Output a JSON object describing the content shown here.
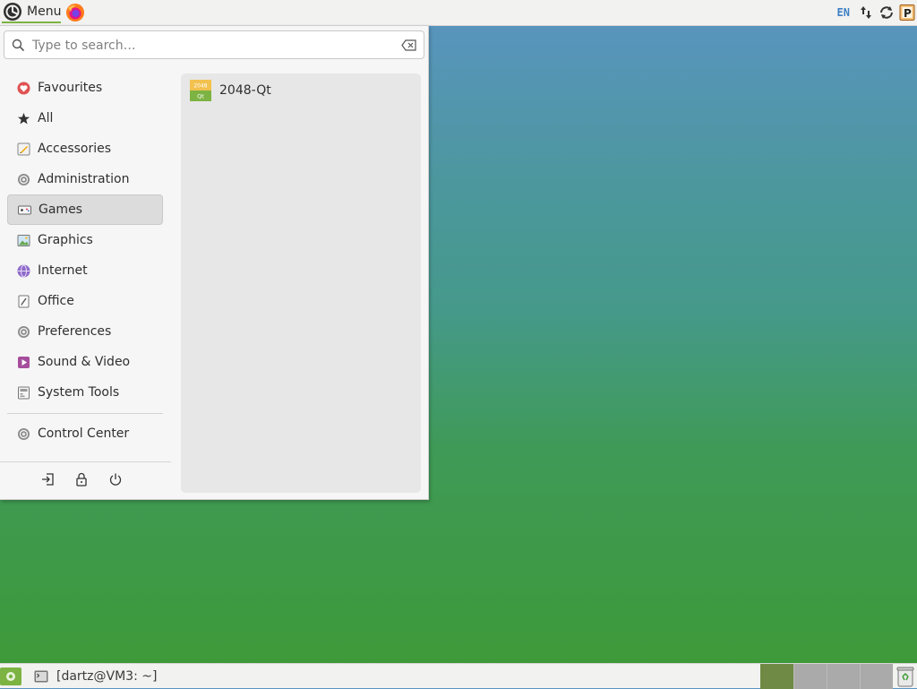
{
  "top_panel": {
    "menu_label": "Menu",
    "keyboard_layout": "EN",
    "launchers": [
      "mate-logo-icon",
      "firefox-icon"
    ],
    "tray_icons": [
      "network-icon",
      "update-icon",
      "parcellite-clipboard-icon"
    ]
  },
  "menu": {
    "search": {
      "placeholder": "Type to search…",
      "value": ""
    },
    "categories": [
      {
        "label": "Favourites",
        "icon": "heart-icon",
        "color": "#e05252"
      },
      {
        "label": "All",
        "icon": "star-icon",
        "color": "#333333"
      },
      {
        "label": "Accessories",
        "icon": "accessories-icon",
        "color": "#4a7cc9"
      },
      {
        "label": "Administration",
        "icon": "gear-icon",
        "color": "#7a7a7a"
      },
      {
        "label": "Games",
        "icon": "gamepad-icon",
        "color": "#555555",
        "selected": true
      },
      {
        "label": "Graphics",
        "icon": "graphics-icon",
        "color": "#6aa84f"
      },
      {
        "label": "Internet",
        "icon": "globe-icon",
        "color": "#8e6ac9"
      },
      {
        "label": "Office",
        "icon": "office-icon",
        "color": "#777777"
      },
      {
        "label": "Preferences",
        "icon": "gear-icon",
        "color": "#7a7a7a"
      },
      {
        "label": "Sound & Video",
        "icon": "multimedia-icon",
        "color": "#a64d9c"
      },
      {
        "label": "System Tools",
        "icon": "system-tools-icon",
        "color": "#7a7a7a"
      }
    ],
    "control_center": {
      "label": "Control Center",
      "icon": "gear-icon"
    },
    "session_buttons": [
      "logout-icon",
      "lock-icon",
      "power-icon"
    ],
    "apps": [
      {
        "label": "2048-Qt",
        "icon": "game-2048-icon",
        "icon_text_top": "2048",
        "icon_text_bottom": "Qt"
      }
    ]
  },
  "bottom_panel": {
    "show_desktop_icon": "show-desktop-icon",
    "task": {
      "label": "[dartz@VM3: ~]",
      "icon": "terminal-icon"
    },
    "workspaces": [
      {
        "active": true
      },
      {
        "active": false
      },
      {
        "active": false
      },
      {
        "active": false
      }
    ],
    "trash_icon": "trash-icon"
  },
  "colors": {
    "accent": "#7cb342",
    "selected_bg": "#dcdcdc",
    "panel_bg": "#f2f2f1",
    "desktop_top": "#5a94c2",
    "desktop_bottom": "#3e9a35"
  }
}
